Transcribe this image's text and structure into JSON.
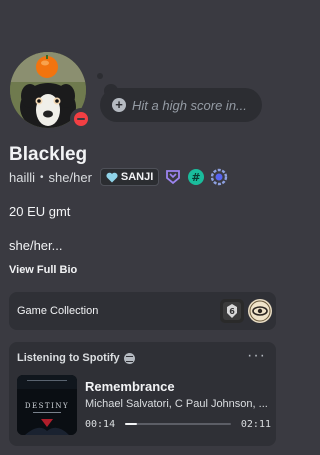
{
  "profile": {
    "display_name": "Blackleg",
    "username": "hailli",
    "separator": "•",
    "pronouns": "she/her",
    "clan_tag": "SANJI",
    "status": "dnd",
    "custom_status_placeholder": "Hit a high score in...",
    "about": "20 EU gmt",
    "bio_preview": "she/her...",
    "view_full_bio": "View Full Bio"
  },
  "badges": [
    "hypesquad-icon",
    "hashtag-badge-icon",
    "quest-badge-icon"
  ],
  "game_collection": {
    "label": "Game Collection",
    "games": [
      "rainbow-six-icon",
      "eye-emblem-icon"
    ]
  },
  "spotify": {
    "header": "Listening to Spotify",
    "more_label": "···",
    "track_title": "Remembrance",
    "artists": "Michael Salvatori, C Paul Johnson, ...",
    "elapsed": "00:14",
    "duration": "02:11",
    "progress": 0.11,
    "album_text": "DESTINY"
  },
  "colors": {
    "background": "#3a3a41",
    "card": "#2f3036",
    "dnd": "#f23f43",
    "hypesquad": "#9c84ef",
    "teal_badge": "#1abc9c"
  }
}
